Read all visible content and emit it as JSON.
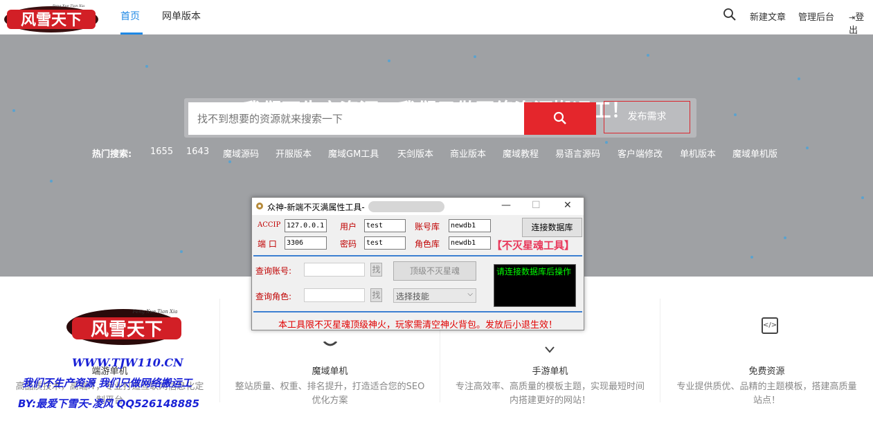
{
  "header": {
    "logo_text": "风雪天下",
    "logo_sub": "Feng Xue Tian Xia",
    "nav": [
      "首页",
      "网单版本"
    ],
    "links": [
      "新建文章",
      "管理后台",
      "登出"
    ]
  },
  "hero": {
    "title": "我们不生产资源，我们只做网络资源搬运工！",
    "search_placeholder": "找不到想要的资源就来搜索一下",
    "publish_label": "发布需求",
    "hot_label": "热门搜索:",
    "hot_tags": [
      "1655",
      "1643",
      "魔域源码",
      "开服版本",
      "魔域GM工具",
      "天剑版本",
      "商业版本",
      "魔域教程",
      "易语言源码",
      "客户端修改",
      "单机版本",
      "魔域单机版"
    ]
  },
  "cards": [
    {
      "title": "端游单机",
      "desc": "高品质技术，高端IT，专业打造互联网信息化定制平台"
    },
    {
      "title": "魔域单机",
      "desc": "整站质量、权重、排名提升，打造适合您的SEO优化方案"
    },
    {
      "title": "手游单机",
      "desc": "专注高效率、高质量的模板主题，实现最短时间内搭建更好的网站！"
    },
    {
      "title": "免费资源",
      "desc": "专业提供质优、品精的主题模板，搭建高质量站点！"
    }
  ],
  "watermark": {
    "url": "WWW.TJW110.CN",
    "slogan": "我们不生产资源  我们只做网络搬运工",
    "by": "BY:最爱下雪天-凌风 QQ526148885"
  },
  "dialog": {
    "title": "众神-新端不灭满属性工具-",
    "accip_label": "ACCIP",
    "accip_value": "127.0.0.1",
    "user_label": "用户",
    "user_value": "test",
    "acc_db_label": "账号库",
    "acc_db_value": "newdb1",
    "connect_label": "连接数据库",
    "port_label": "端 口",
    "port_value": "3306",
    "pwd_label": "密码",
    "pwd_value": "test",
    "role_db_label": "角色库",
    "role_db_value": "newdb1",
    "tool_name": "【不灭星魂工具】",
    "query_acc_label": "查询账号:",
    "find_label": "找",
    "top_star_label": "顶级不灭星魂",
    "query_role_label": "查询角色:",
    "skill_select": "选择技能",
    "status": "请连接数据库后操作",
    "footer_note": "本工具限不灭星魂顶级神火，玩家需清空神火背包。发放后小退生效！",
    "minimize": "—",
    "maximize": "☐",
    "close": "✕"
  }
}
